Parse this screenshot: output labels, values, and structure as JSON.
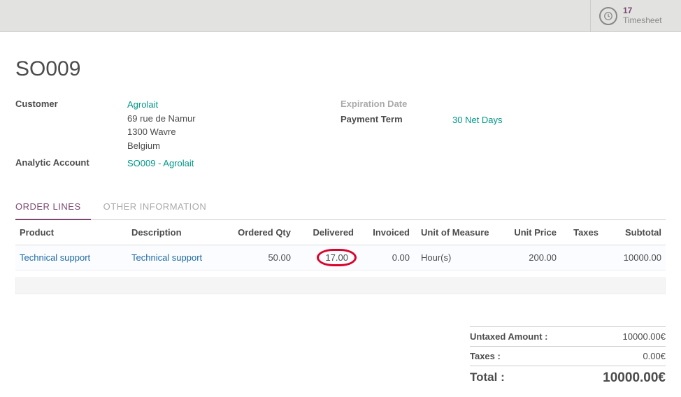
{
  "header": {
    "timesheet_count": "17",
    "timesheet_label": "Timesheet"
  },
  "order": {
    "name": "SO009",
    "customer_label": "Customer",
    "customer_name": "Agrolait",
    "customer_street": "69 rue de Namur",
    "customer_city": "1300 Wavre",
    "customer_country": "Belgium",
    "analytic_label": "Analytic Account",
    "analytic_value": "SO009 - Agrolait",
    "expiration_label": "Expiration Date",
    "payment_term_label": "Payment Term",
    "payment_term_value": "30 Net Days"
  },
  "tabs": {
    "order_lines": "ORDER LINES",
    "other_info": "OTHER INFORMATION"
  },
  "table": {
    "headers": {
      "product": "Product",
      "description": "Description",
      "ordered": "Ordered Qty",
      "delivered": "Delivered",
      "invoiced": "Invoiced",
      "uom": "Unit of Measure",
      "unit_price": "Unit Price",
      "taxes": "Taxes",
      "subtotal": "Subtotal"
    },
    "rows": [
      {
        "product": "Technical support",
        "description": "Technical support",
        "ordered": "50.00",
        "delivered": "17.00",
        "invoiced": "0.00",
        "uom": "Hour(s)",
        "unit_price": "200.00",
        "taxes": "",
        "subtotal": "10000.00"
      }
    ]
  },
  "totals": {
    "untaxed_label": "Untaxed Amount :",
    "untaxed_value": "10000.00€",
    "taxes_label": "Taxes :",
    "taxes_value": "0.00€",
    "total_label": "Total :",
    "total_value": "10000.00€"
  }
}
